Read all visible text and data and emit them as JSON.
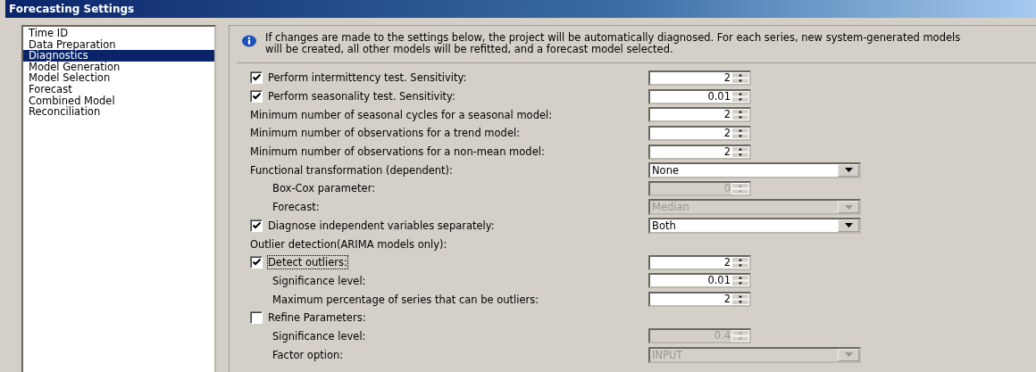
{
  "window": {
    "title": "Forecasting Settings"
  },
  "sidebar": {
    "items": [
      {
        "label": "Time ID",
        "selected": false
      },
      {
        "label": "Data Preparation",
        "selected": false
      },
      {
        "label": "Diagnostics",
        "selected": true
      },
      {
        "label": "Model Generation",
        "selected": false
      },
      {
        "label": "Model Selection",
        "selected": false
      },
      {
        "label": "Forecast",
        "selected": false
      },
      {
        "label": "Combined Model",
        "selected": false
      },
      {
        "label": "Reconciliation",
        "selected": false
      }
    ]
  },
  "info": {
    "text": "If changes are made to the settings below, the project will be automatically diagnosed. For each series, new system-generated models will be created, all other models will be refitted, and a forecast model selected."
  },
  "rows": [
    {
      "kind": "checkbox",
      "label": "Perform intermittency test. Sensitivity:",
      "checked": true,
      "focused": false,
      "control": {
        "kind": "spin",
        "value": "2",
        "disabled": false
      }
    },
    {
      "kind": "checkbox",
      "label": "Perform seasonality test. Sensitivity:",
      "checked": true,
      "focused": false,
      "control": {
        "kind": "spin",
        "value": "0.01",
        "disabled": false
      }
    },
    {
      "kind": "label",
      "label": "Minimum number of seasonal cycles for a seasonal model:",
      "control": {
        "kind": "spin",
        "value": "2",
        "disabled": false
      }
    },
    {
      "kind": "label",
      "label": "Minimum number of observations for a trend model:",
      "control": {
        "kind": "spin",
        "value": "2",
        "disabled": false
      }
    },
    {
      "kind": "label",
      "label": "Minimum number of observations for a non-mean model:",
      "control": {
        "kind": "spin",
        "value": "2",
        "disabled": false
      }
    },
    {
      "kind": "label",
      "label": "Functional transformation (dependent):",
      "control": {
        "kind": "combo",
        "value": "None",
        "disabled": false
      },
      "children": [
        {
          "kind": "label",
          "label": "Box-Cox parameter:",
          "control": {
            "kind": "spin",
            "value": "0",
            "disabled": true
          }
        },
        {
          "kind": "label",
          "label": "Forecast:",
          "control": {
            "kind": "combo",
            "value": "Median",
            "disabled": true
          }
        }
      ]
    },
    {
      "kind": "checkbox",
      "label": "Diagnose independent variables separately:",
      "checked": true,
      "focused": false,
      "control": {
        "kind": "combo",
        "value": "Both",
        "disabled": false
      }
    },
    {
      "kind": "label",
      "label": "Outlier detection(ARIMA models only):"
    },
    {
      "kind": "checkbox",
      "label": "Detect outliers:",
      "checked": true,
      "focused": true,
      "control": {
        "kind": "spin",
        "value": "2",
        "disabled": false
      },
      "children": [
        {
          "kind": "label",
          "label": "Significance level:",
          "control": {
            "kind": "spin",
            "value": "0.01",
            "disabled": false
          }
        },
        {
          "kind": "label",
          "label": "Maximum percentage of series that can be outliers:",
          "control": {
            "kind": "spin",
            "value": "2",
            "disabled": false
          }
        }
      ]
    },
    {
      "kind": "checkbox",
      "label": "Refine Parameters:",
      "checked": false,
      "focused": false,
      "children": [
        {
          "kind": "label",
          "label": "Significance level:",
          "control": {
            "kind": "spin",
            "value": "0.4",
            "disabled": true
          }
        },
        {
          "kind": "label",
          "label": "Factor option:",
          "control": {
            "kind": "combo",
            "value": "INPUT",
            "disabled": true
          }
        }
      ]
    }
  ]
}
